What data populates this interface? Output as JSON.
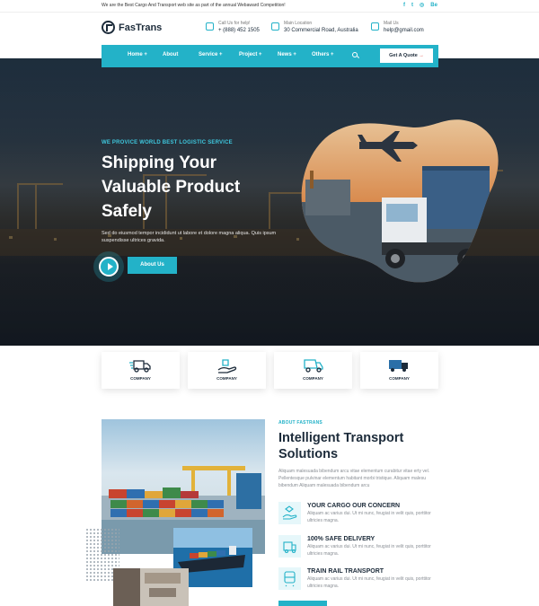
{
  "topbar": {
    "message": "We are the Best Cargo And Transport web site as part of the annual Webaward Competition!",
    "socials": [
      "f",
      "t",
      "◎",
      "Be"
    ]
  },
  "header": {
    "logo": "FasTrans",
    "contacts": [
      {
        "label": "Call Us for help!",
        "value": "+ (888) 452 1505",
        "icon": "phone-icon"
      },
      {
        "label": "Main Location",
        "value": "30 Commercial Road, Australia",
        "icon": "location-icon"
      },
      {
        "label": "Mail Us",
        "value": "help@gmail.com",
        "icon": "mail-icon"
      }
    ]
  },
  "nav": {
    "items": [
      "Home +",
      "About",
      "Service +",
      "Project +",
      "News +",
      "Others +"
    ],
    "quote_label": "Get A Quote"
  },
  "hero": {
    "subtitle": "WE PROVICE WORLD BEST LOGISTIC SERVICE",
    "title": "Shipping Your Valuable Product Safely",
    "text": "Sed do eiusmod tempor incididunt ut labore et dolore magna aliqua. Quis ipsum suspendisse ultrices gravida.",
    "about_button": "About Us"
  },
  "companies": [
    "COMPANY",
    "COMPANY",
    "COMPANY",
    "COMPANY"
  ],
  "about": {
    "subtitle": "ABOUT FASTRANS",
    "title": "Intelligent Transport Solutions",
    "text": "Aliquam malesuada bibendum arcu vitae elementum curabitur vitae erty vel. Pellentesque pulvinar elementum habitant morbi tristique. Aliquam malesu bibendum Aliquam malesuada bibendum arcu",
    "features": [
      {
        "title": "YOUR CARGO OUR CONCERN",
        "text": "Aliquam ac varius dui. Ut mi nunc, feugiat in velit quis, porttitor ultricies magna."
      },
      {
        "title": "100% SAFE DELIVERY",
        "text": "Aliquam ac varius dui. Ut mi nunc, feugiat in velit quis, porttitor ultricies magna."
      },
      {
        "title": "TRAIN RAIL TRANSPORT",
        "text": "Aliquam ac varius dui. Ut mi nunc, feugiat in velit quis, porttitor ultricies magna."
      }
    ]
  },
  "colors": {
    "accent": "#23b2c8",
    "dark": "#1c2b3a"
  }
}
